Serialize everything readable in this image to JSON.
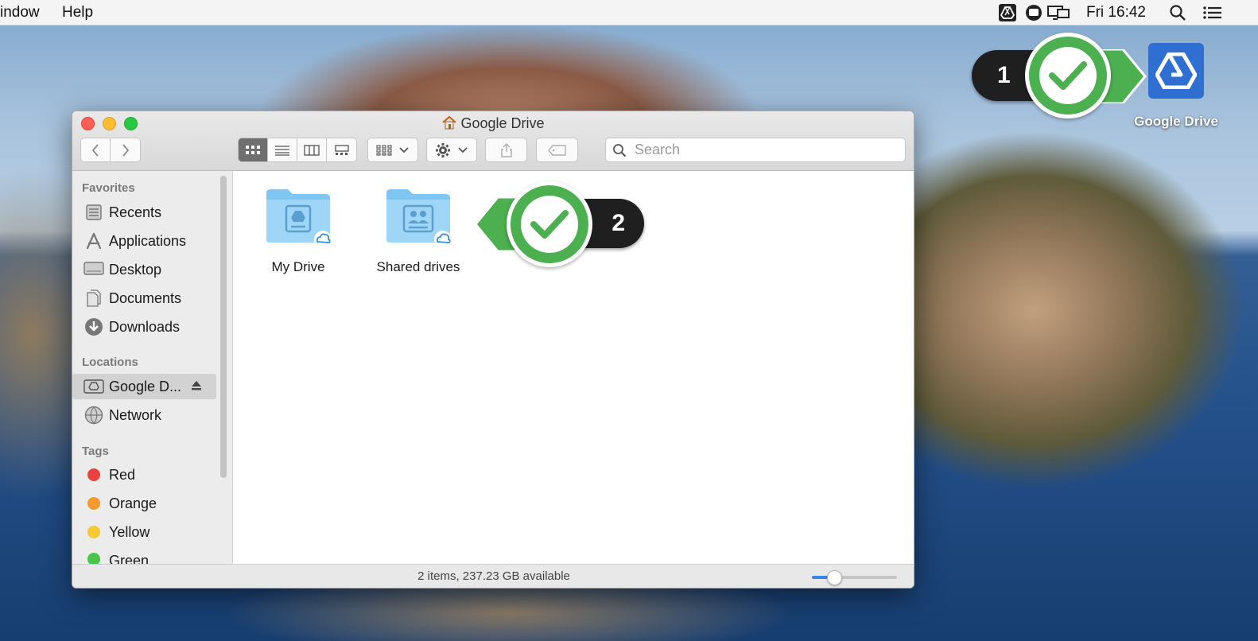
{
  "menubar": {
    "items": [
      "indow",
      "Help"
    ],
    "clock": "Fri 16:42",
    "icons": [
      "google-drive-menu-icon",
      "cat-menu-icon",
      "display-menu-icon",
      "search-icon",
      "list-icon"
    ]
  },
  "callouts": {
    "first": "1",
    "second": "2",
    "color": "#4caf50"
  },
  "desktop": {
    "drive_label": "Google Drive"
  },
  "window": {
    "title": "Google Drive",
    "search_placeholder": "Search",
    "sidebar": {
      "favorites_heading": "Favorites",
      "favorites": [
        "Recents",
        "Applications",
        "Desktop",
        "Documents",
        "Downloads"
      ],
      "locations_heading": "Locations",
      "locations": [
        "Google D...",
        "Network"
      ],
      "tags_heading": "Tags",
      "tags": [
        {
          "label": "Red",
          "color": "#ec4141"
        },
        {
          "label": "Orange",
          "color": "#f49a2f"
        },
        {
          "label": "Yellow",
          "color": "#f6c932"
        },
        {
          "label": "Green",
          "color": "#4cc34b"
        }
      ]
    },
    "items": [
      "My Drive",
      "Shared drives"
    ],
    "status": "2 items, 237.23 GB available",
    "zoom_level": 0.25
  },
  "colors": {
    "accent": "#3a82f7",
    "folder": "#8fd0f7"
  }
}
